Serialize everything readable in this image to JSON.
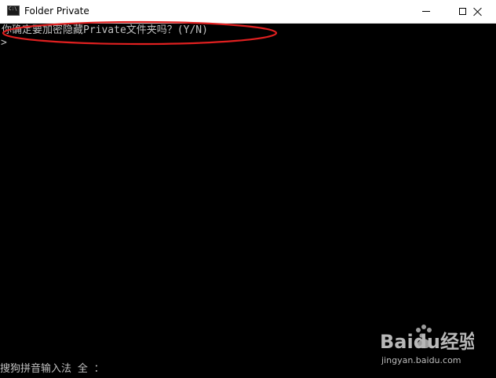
{
  "window": {
    "title": "Folder Private",
    "icon": "console-icon",
    "icon_text": "C:\\",
    "controls": {
      "minimize": "minimize-icon",
      "maximize": "maximize-icon",
      "close": "close-icon"
    }
  },
  "console": {
    "prompt": "你确定要加密隐藏Private文件夹吗？(Y/N)",
    "cursor": ">",
    "ime_status": "搜狗拼音输入法 全 ："
  },
  "annotation": {
    "highlight_color": "#e02020"
  },
  "watermark": {
    "brand": "Baidu经验",
    "url": "jingyan.baidu.com"
  },
  "colors": {
    "console_bg": "#000000",
    "console_text": "#c0c0c0",
    "titlebar_bg": "#ffffff"
  }
}
